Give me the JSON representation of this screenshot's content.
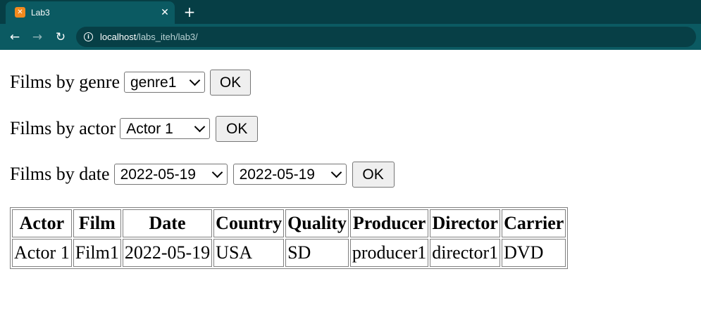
{
  "browser": {
    "tab_title": "Lab3",
    "url_host": "localhost",
    "url_path": "/labs_iteh/lab3/",
    "icons": {
      "favicon": "xampp-icon",
      "close": "close-icon",
      "new_tab": "plus-icon",
      "back": "arrow-left-icon",
      "forward": "arrow-right-icon",
      "reload": "reload-icon",
      "site_info": "info-icon"
    }
  },
  "filters": {
    "genre": {
      "label": "Films by genre",
      "selected": "genre1",
      "button": "OK"
    },
    "actor": {
      "label": "Films by actor",
      "selected": "Actor 1",
      "button": "OK"
    },
    "date": {
      "label": "Films by date",
      "from": "2022-05-19",
      "to": "2022-05-19",
      "button": "OK"
    }
  },
  "table": {
    "headers": [
      "Actor",
      "Film",
      "Date",
      "Country",
      "Quality",
      "Producer",
      "Director",
      "Carrier"
    ],
    "rows": [
      [
        "Actor 1",
        "Film1",
        "2022-05-19",
        "USA",
        "SD",
        "producer1",
        "director1",
        "DVD"
      ]
    ]
  },
  "colors": {
    "tabbar_bg": "#063e45",
    "toolbar_bg": "#0b5a62",
    "omnibox_bg": "#073f46"
  }
}
